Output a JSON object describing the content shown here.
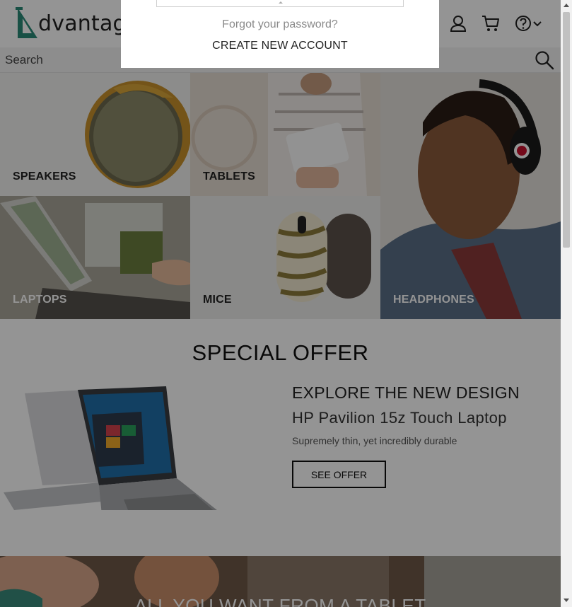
{
  "header": {
    "logo_text": "dvantage",
    "icons": [
      "user-icon",
      "cart-icon",
      "help-icon",
      "chevron-down-icon"
    ]
  },
  "search": {
    "placeholder": "Search"
  },
  "categories": [
    {
      "label": "SPEAKERS"
    },
    {
      "label": "TABLETS"
    },
    {
      "label": "HEADPHONES"
    },
    {
      "label": "LAPTOPS"
    },
    {
      "label": "MICE"
    }
  ],
  "special_offer": {
    "title": "SPECIAL OFFER",
    "headline": "EXPLORE THE NEW DESIGN",
    "product": "HP Pavilion 15z Touch Laptop",
    "tagline": "Supremely thin, yet incredibly durable",
    "button": "SEE OFFER"
  },
  "banner": {
    "text": "ALL YOU WANT FROM A TABLET"
  },
  "login_popup": {
    "forgot_password": "Forgot your password?",
    "create_account": "CREATE NEW ACCOUNT"
  },
  "colors": {
    "brand": "#2a8a78",
    "overlay": "rgba(0,0,0,0.42)"
  }
}
